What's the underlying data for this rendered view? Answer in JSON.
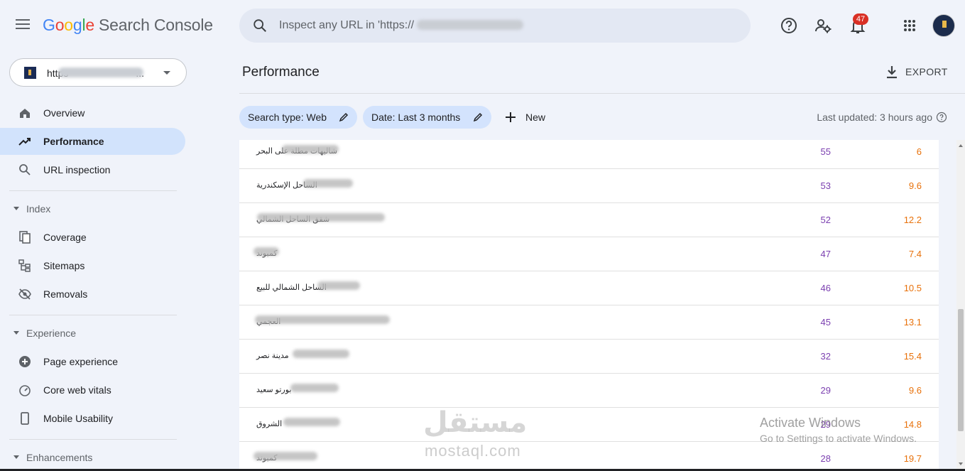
{
  "header": {
    "logo_brand": "Google",
    "logo_product": "Search Console",
    "search_placeholder": "Inspect any URL in 'https://",
    "search_placeholder_tail": "'",
    "notification_count": "47"
  },
  "sidebar": {
    "property_prefix": "https",
    "property_suffix": "...",
    "nav": [
      {
        "label": "Overview",
        "icon": "home-icon"
      },
      {
        "label": "Performance",
        "icon": "trending-up-icon",
        "active": true
      },
      {
        "label": "URL inspection",
        "icon": "search-icon"
      }
    ],
    "sections": [
      {
        "label": "Index",
        "items": [
          {
            "label": "Coverage",
            "icon": "coverage-icon"
          },
          {
            "label": "Sitemaps",
            "icon": "sitemap-icon"
          },
          {
            "label": "Removals",
            "icon": "visibility-off-icon"
          }
        ]
      },
      {
        "label": "Experience",
        "items": [
          {
            "label": "Page experience",
            "icon": "page-experience-icon"
          },
          {
            "label": "Core web vitals",
            "icon": "gauge-icon"
          },
          {
            "label": "Mobile Usability",
            "icon": "phone-icon"
          }
        ]
      },
      {
        "label": "Enhancements",
        "items": []
      }
    ]
  },
  "main": {
    "title": "Performance",
    "export_label": "EXPORT",
    "filters": [
      {
        "label": "Search type: Web"
      },
      {
        "label": "Date: Last 3 months"
      }
    ],
    "new_label": "New",
    "last_updated": "Last updated: 3 hours ago"
  },
  "rows": [
    {
      "query": "شاليهات مطلة على البحر",
      "clicks": "55",
      "impressions": "6"
    },
    {
      "query": "الساحل الإسكندرية",
      "clicks": "53",
      "impressions": "9.6"
    },
    {
      "query": "شقق الساحل الشمالي",
      "clicks": "52",
      "impressions": "12.2"
    },
    {
      "query": "كمبوند",
      "clicks": "47",
      "impressions": "7.4"
    },
    {
      "query": "الساحل الشمالي للبيع",
      "clicks": "46",
      "impressions": "10.5"
    },
    {
      "query": "العجمي",
      "clicks": "45",
      "impressions": "13.1"
    },
    {
      "query": "مدينة نصر",
      "clicks": "32",
      "impressions": "15.4"
    },
    {
      "query": "بورتو سعيد",
      "clicks": "29",
      "impressions": "9.6"
    },
    {
      "query": "الشروق",
      "clicks": "29",
      "impressions": "14.8"
    },
    {
      "query": "كمبوند",
      "clicks": "28",
      "impressions": "19.7"
    }
  ],
  "overlays": {
    "watermark_ar": "مستقل",
    "watermark_url": "mostaql.com",
    "activate_title": "Activate Windows",
    "activate_sub": "Go to Settings to activate Windows."
  },
  "colors": {
    "accent_blue": "#1a73e8",
    "active_nav_bg": "#d2e3fc",
    "clicks_purple": "#7b3fb0",
    "impressions_orange": "#e8710a",
    "badge_red": "#d93025"
  }
}
